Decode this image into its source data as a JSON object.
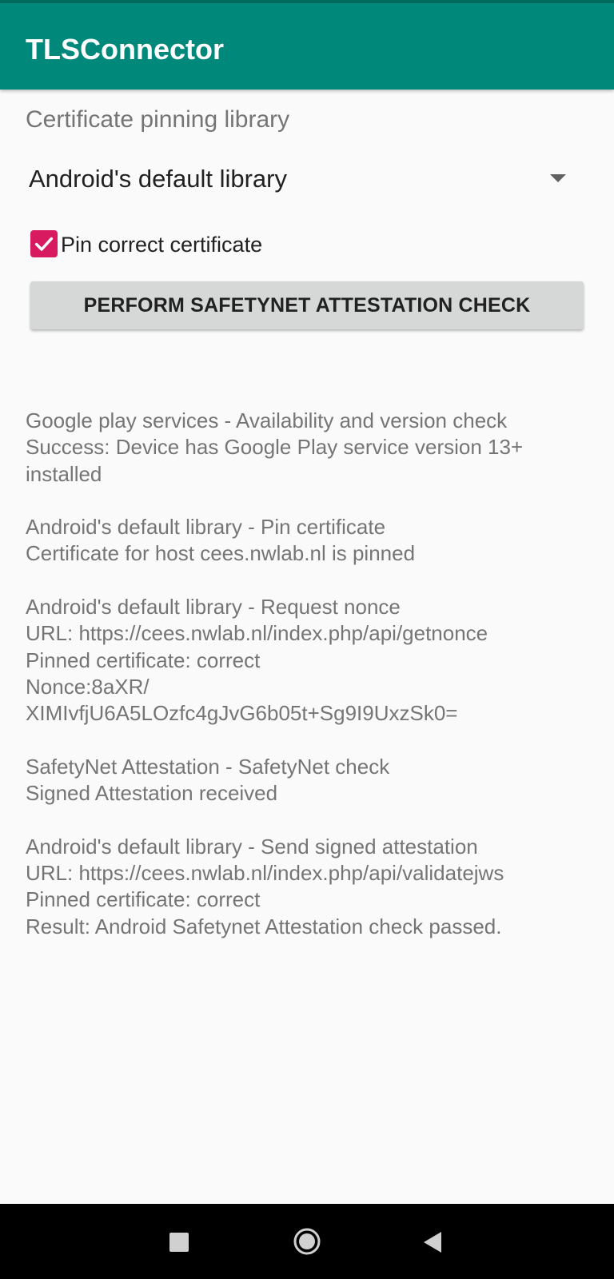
{
  "app_bar": {
    "title": "TLSConnector"
  },
  "form": {
    "library_label": "Certificate pinning library",
    "library_spinner": {
      "selected": "Android's default library",
      "icon": "dropdown-arrow-icon"
    },
    "pin_checkbox": {
      "label": "Pin correct certificate",
      "checked": true,
      "color": "#d81b60"
    },
    "action_button": {
      "label": "PERFORM SAFETYNET ATTESTATION CHECK"
    }
  },
  "log": [
    {
      "lines": [
        "Google play services - Availability and version check",
        "Success: Device has Google Play service version 13+",
        "installed"
      ]
    },
    {
      "lines": [
        "Android's default library - Pin certificate",
        "Certificate for host cees.nwlab.nl is pinned"
      ]
    },
    {
      "lines": [
        "Android's default library - Request nonce",
        "URL: https://cees.nwlab.nl/index.php/api/getnonce",
        "Pinned certificate: correct",
        "Nonce:8aXR/",
        "XIMIvfjU6A5LOzfc4gJvG6b05t+Sg9I9UxzSk0="
      ]
    },
    {
      "lines": [
        "SafetyNet Attestation - SafetyNet check",
        "Signed Attestation received"
      ]
    },
    {
      "lines": [
        "Android's default library - Send signed attestation",
        "URL: https://cees.nwlab.nl/index.php/api/validatejws",
        "Pinned certificate: correct",
        "Result: Android Safetynet Attestation check passed."
      ]
    }
  ],
  "nav_bar": {
    "icons": [
      "recents-square-icon",
      "home-circle-icon",
      "back-triangle-icon"
    ]
  },
  "colors": {
    "primary": "#00897b",
    "primary_dark": "#006a5e",
    "accent": "#d81b60"
  }
}
